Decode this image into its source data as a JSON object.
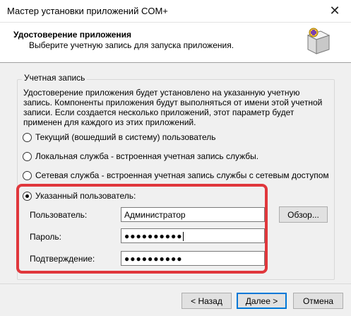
{
  "window": {
    "title": "Мастер установки приложений COM+",
    "close_glyph": "✕"
  },
  "header": {
    "title": "Удостоверение приложения",
    "subtitle": "Выберите учетную запись для запуска приложения.",
    "icon": "wizard-box-icon"
  },
  "account_group": {
    "label": "Учетная запись",
    "description": "Удостоверение приложения будет установлено на указанную учетную запись. Компоненты приложения будут выполняться от имени этой учетной записи. Если создается несколько приложений, этот параметр будет применен для каждого из этих приложений.",
    "options": [
      {
        "label": "Текущий (вошедший в систему) пользователь",
        "selected": false
      },
      {
        "label": "Локальная служба - встроенная учетная запись службы.",
        "selected": false
      },
      {
        "label": "Сетевая служба - встроенная учетная запись службы с сетевым доступом",
        "selected": false
      },
      {
        "label": "Указанный пользователь:",
        "selected": true
      }
    ],
    "fields": {
      "user_label": "Пользователь:",
      "user_value": "Администратор",
      "password_label": "Пароль:",
      "password_value": "●●●●●●●●●●",
      "confirm_label": "Подтверждение:",
      "confirm_value": "●●●●●●●●●●"
    },
    "browse_button": "Обзор..."
  },
  "footer": {
    "back_button": "< Назад",
    "next_button": "Далее >",
    "cancel_button": "Отмена"
  },
  "colors": {
    "highlight": "#e0373c",
    "default_button_border": "#0078d7"
  }
}
